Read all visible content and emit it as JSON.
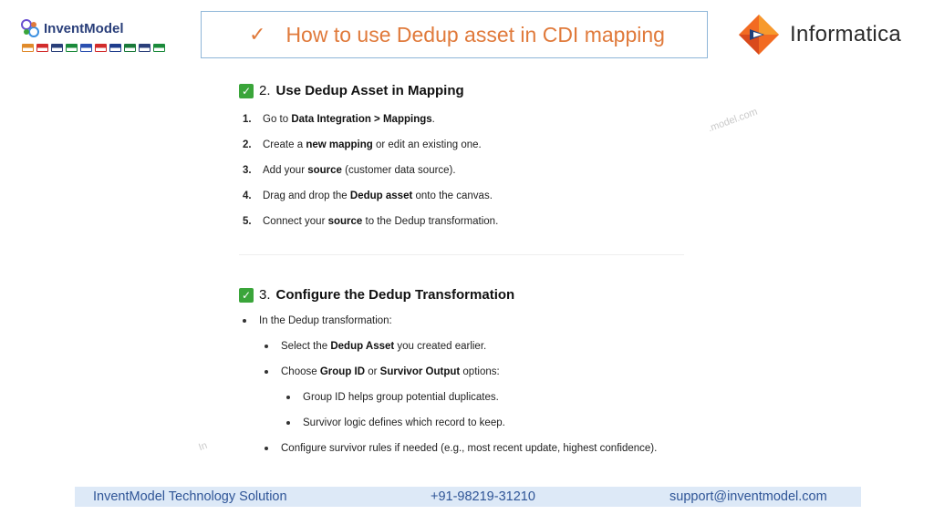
{
  "brand": {
    "name": "InventModel",
    "flags": [
      "#e08a2a",
      "#d22b2b",
      "#2a3f7a",
      "#1a8a3a",
      "#2a4fb0",
      "#d22b2b",
      "#1e3c8c",
      "#1a7a3a",
      "#2a3f7a",
      "#1a8a3a"
    ]
  },
  "header": {
    "check": "✓",
    "title": "How to use Dedup asset in CDI mapping",
    "vendor": "Informatica"
  },
  "section2": {
    "check": "✓",
    "number": "2.",
    "title": "Use Dedup Asset in Mapping",
    "items": [
      {
        "n": "1.",
        "parts": [
          {
            "t": "Go to "
          },
          {
            "t": "Data Integration > Mappings",
            "b": true
          },
          {
            "t": "."
          }
        ]
      },
      {
        "n": "2.",
        "parts": [
          {
            "t": "Create a "
          },
          {
            "t": "new mapping",
            "b": true
          },
          {
            "t": " or edit an existing one."
          }
        ]
      },
      {
        "n": "3.",
        "parts": [
          {
            "t": "Add your "
          },
          {
            "t": "source",
            "b": true
          },
          {
            "t": " (customer data source)."
          }
        ]
      },
      {
        "n": "4.",
        "parts": [
          {
            "t": "Drag and drop the "
          },
          {
            "t": "Dedup asset",
            "b": true
          },
          {
            "t": " onto the canvas."
          }
        ]
      },
      {
        "n": "5.",
        "parts": [
          {
            "t": "Connect your "
          },
          {
            "t": "source",
            "b": true
          },
          {
            "t": " to the Dedup transformation."
          }
        ]
      }
    ]
  },
  "section3": {
    "check": "✓",
    "number": "3.",
    "title": "Configure the Dedup Transformation",
    "bullets": [
      {
        "level": 0,
        "parts": [
          {
            "t": "In the Dedup transformation:"
          }
        ]
      },
      {
        "level": 1,
        "parts": [
          {
            "t": "Select the "
          },
          {
            "t": "Dedup Asset",
            "b": true
          },
          {
            "t": " you created earlier."
          }
        ]
      },
      {
        "level": 1,
        "parts": [
          {
            "t": "Choose "
          },
          {
            "t": "Group ID",
            "b": true
          },
          {
            "t": " or "
          },
          {
            "t": "Survivor Output",
            "b": true
          },
          {
            "t": " options:"
          }
        ]
      },
      {
        "level": 2,
        "parts": [
          {
            "t": "Group ID helps group potential duplicates."
          }
        ]
      },
      {
        "level": 2,
        "parts": [
          {
            "t": "Survivor logic defines which record to keep."
          }
        ]
      },
      {
        "level": 1,
        "parts": [
          {
            "t": "Configure survivor rules if needed (e.g., most recent update, highest confidence)."
          }
        ]
      }
    ]
  },
  "watermarks": [
    ".model.com",
    "In"
  ],
  "footer": {
    "company": "InventModel Technology Solution",
    "phone": "+91-98219-31210",
    "email": "support@inventmodel.com"
  }
}
